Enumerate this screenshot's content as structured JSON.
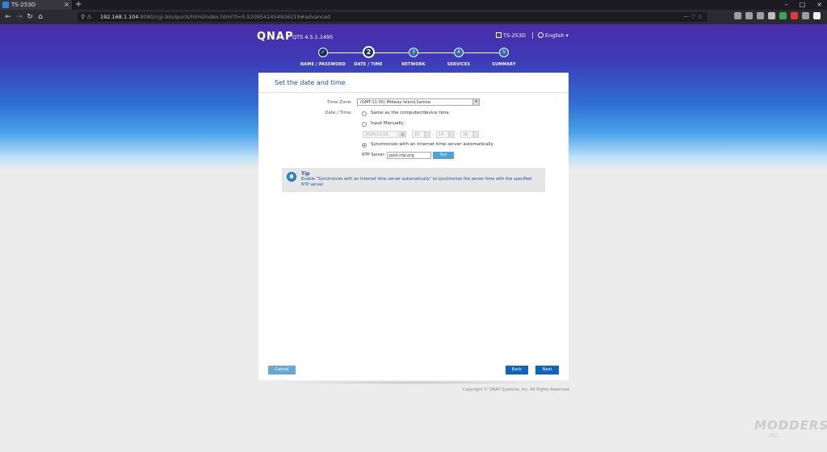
{
  "browser": {
    "tab_title": "TS-253D",
    "tab_close": "×",
    "new_tab": "+",
    "url_host": "192.168.1.104",
    "url_rest": ":8080/cgi-bin/quick/html/index.html?t=0.5209541454926219#advanced",
    "url_right_icons": "··· ♡ ☆",
    "win_min": "–",
    "win_max": "□",
    "win_close": "×"
  },
  "header": {
    "brand": "QNAP",
    "version": "QTS 4.5.1.1495",
    "device_name": "TS-253D",
    "separator": "|",
    "language": "English"
  },
  "steps": [
    {
      "number": "✓",
      "label": "NAME / PASSWORD",
      "state": "done"
    },
    {
      "number": "2",
      "label": "DATE / TIME",
      "state": "active"
    },
    {
      "number": "3",
      "label": "NETWORK",
      "state": "pending"
    },
    {
      "number": "4",
      "label": "SERVICES",
      "state": "pending"
    },
    {
      "number": "5",
      "label": "SUMMARY",
      "state": "pending"
    }
  ],
  "form": {
    "title": "Set the date and time",
    "timezone_label": "Time Zone:",
    "timezone_value": "(GMT-11:00) Midway Island,Samoa",
    "datetime_label": "Date / Time:",
    "option_same": "Same as the computer/device time",
    "option_manual": "Input Manually",
    "manual_date": "2020/11/20",
    "manual_hour": "15",
    "manual_minute": "14",
    "manual_second": "36",
    "colon": ":",
    "option_sync": "Synchronize with an Internet time server automatically",
    "ntp_label": "NTP Server:",
    "ntp_value": "pool.ntp.org",
    "test_button": "Test"
  },
  "tip": {
    "title": "Tip",
    "text": "Enable \"Synchronize with an Internet time server automatically\" to synchronize the server time with the specified NTP server."
  },
  "buttons": {
    "cancel": "Cancel",
    "back": "Back",
    "next": "Next"
  },
  "footer": {
    "copyright": "Copyright © QNAP Systems, Inc. All Rights Reserved."
  },
  "watermark": {
    "main": "MODDERS",
    "sub": "INC."
  },
  "colors": {
    "accent": "#0f65b9",
    "title_blue": "#1d4fa0",
    "cancel_blue": "#67a9d3"
  }
}
